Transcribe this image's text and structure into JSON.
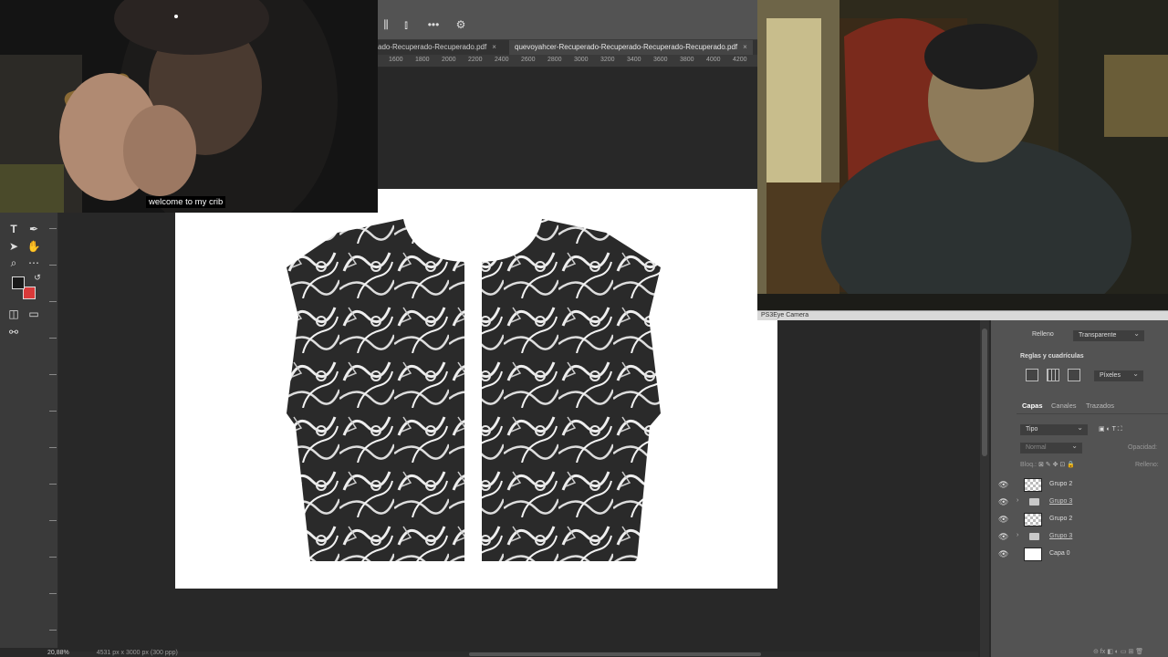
{
  "tabs": [
    {
      "label": "ado-Recuperado-Recuperado.pdf",
      "close": "×"
    },
    {
      "label": "quevoyahcer-Recuperado-Recuperado-Recuperado-Recuperado.pdf",
      "close": "×"
    }
  ],
  "ruler_ticks": [
    "1600",
    "1800",
    "2000",
    "2200",
    "2400",
    "2600",
    "2800",
    "3000",
    "3200",
    "3400",
    "3600",
    "3800",
    "4000",
    "4200"
  ],
  "toolbar_icons": [
    "type-tool-icon",
    "pen-tool-icon",
    "move-select-icon",
    "hand-tool-icon",
    "zoom-tool-icon",
    "more-tools-icon"
  ],
  "colors": {
    "foreground": "#1a1a1a",
    "background": "#d93a3a",
    "accent": "#4ea3ff"
  },
  "webcam_left": {
    "subtitle": "welcome to my crib"
  },
  "webcam_right": {
    "label": "PS3Eye Camera"
  },
  "properties": {
    "fill_label": "Relleno",
    "fill_value": "Transparente",
    "grids_title": "Reglas y cuadrículas",
    "units_value": "Píxeles"
  },
  "layers_panel": {
    "tab_layers": "Capas",
    "tab_channels": "Canales",
    "tab_paths": "Trazados",
    "filter_value": "Tipo",
    "blend_mode": "Normal",
    "opacity_label": "Opacidad:",
    "lock_label": "Bloq.:",
    "fill_label": "Relleno:",
    "layers": [
      {
        "name": "Grupo 2",
        "kind": "pixel"
      },
      {
        "name": "Grupo 3",
        "kind": "group"
      },
      {
        "name": "Grupo 2",
        "kind": "pixel"
      },
      {
        "name": "Grupo 3",
        "kind": "group"
      },
      {
        "name": "Capa 0",
        "kind": "white"
      }
    ]
  },
  "status": {
    "zoom": "20,88%",
    "doc_size": "4531 px x 3000 px (300 ppp)"
  }
}
